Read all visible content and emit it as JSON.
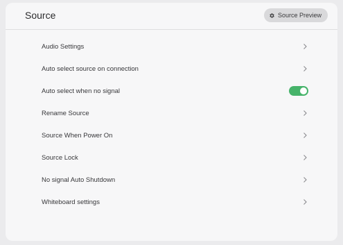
{
  "header": {
    "title": "Source",
    "preview_button": {
      "label": "Source Preview",
      "icon": "gear-icon"
    }
  },
  "settings": [
    {
      "label": "Audio Settings",
      "control": "chevron"
    },
    {
      "label": "Auto select source on connection",
      "control": "chevron"
    },
    {
      "label": "Auto select when no signal",
      "control": "toggle",
      "enabled": true
    },
    {
      "label": "Rename Source",
      "control": "chevron"
    },
    {
      "label": "Source When Power On",
      "control": "chevron"
    },
    {
      "label": "Source Lock",
      "control": "chevron"
    },
    {
      "label": "No signal Auto Shutdown",
      "control": "chevron"
    },
    {
      "label": "Whiteboard settings",
      "control": "chevron"
    }
  ],
  "colors": {
    "toggle_on": "#46b36a",
    "background": "#f7f7f8",
    "button_bg": "#d9d9db"
  }
}
